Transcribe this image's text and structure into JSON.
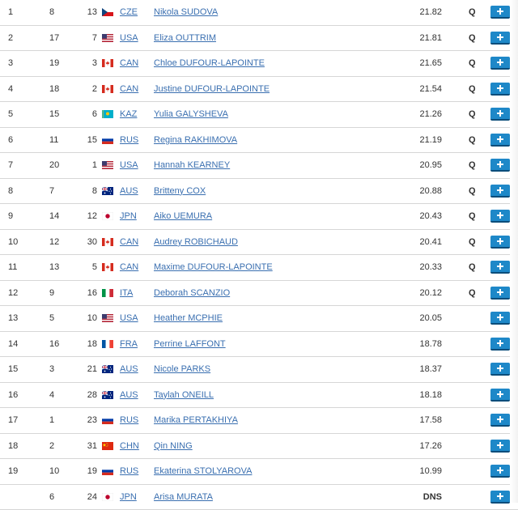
{
  "rows": [
    {
      "rank": "1",
      "bib": "8",
      "start": "13",
      "flag": "cze",
      "nation": "CZE",
      "athlete": "Nikola SUDOVA",
      "score": "21.82",
      "q": "Q"
    },
    {
      "rank": "2",
      "bib": "17",
      "start": "7",
      "flag": "usa",
      "nation": "USA",
      "athlete": "Eliza OUTTRIM",
      "score": "21.81",
      "q": "Q"
    },
    {
      "rank": "3",
      "bib": "19",
      "start": "3",
      "flag": "can",
      "nation": "CAN",
      "athlete": "Chloe DUFOUR-LAPOINTE",
      "score": "21.65",
      "q": "Q"
    },
    {
      "rank": "4",
      "bib": "18",
      "start": "2",
      "flag": "can",
      "nation": "CAN",
      "athlete": "Justine DUFOUR-LAPOINTE",
      "score": "21.54",
      "q": "Q"
    },
    {
      "rank": "5",
      "bib": "15",
      "start": "6",
      "flag": "kaz",
      "nation": "KAZ",
      "athlete": "Yulia GALYSHEVA",
      "score": "21.26",
      "q": "Q"
    },
    {
      "rank": "6",
      "bib": "11",
      "start": "15",
      "flag": "rus",
      "nation": "RUS",
      "athlete": "Regina RAKHIMOVA",
      "score": "21.19",
      "q": "Q"
    },
    {
      "rank": "7",
      "bib": "20",
      "start": "1",
      "flag": "usa",
      "nation": "USA",
      "athlete": "Hannah KEARNEY",
      "score": "20.95",
      "q": "Q"
    },
    {
      "rank": "8",
      "bib": "7",
      "start": "8",
      "flag": "aus",
      "nation": "AUS",
      "athlete": "Britteny COX",
      "score": "20.88",
      "q": "Q"
    },
    {
      "rank": "9",
      "bib": "14",
      "start": "12",
      "flag": "jpn",
      "nation": "JPN",
      "athlete": "Aiko UEMURA",
      "score": "20.43",
      "q": "Q"
    },
    {
      "rank": "10",
      "bib": "12",
      "start": "30",
      "flag": "can",
      "nation": "CAN",
      "athlete": "Audrey ROBICHAUD",
      "score": "20.41",
      "q": "Q"
    },
    {
      "rank": "11",
      "bib": "13",
      "start": "5",
      "flag": "can",
      "nation": "CAN",
      "athlete": "Maxime DUFOUR-LAPOINTE",
      "score": "20.33",
      "q": "Q"
    },
    {
      "rank": "12",
      "bib": "9",
      "start": "16",
      "flag": "ita",
      "nation": "ITA",
      "athlete": "Deborah SCANZIO",
      "score": "20.12",
      "q": "Q"
    },
    {
      "rank": "13",
      "bib": "5",
      "start": "10",
      "flag": "usa",
      "nation": "USA",
      "athlete": "Heather MCPHIE",
      "score": "20.05",
      "q": ""
    },
    {
      "rank": "14",
      "bib": "16",
      "start": "18",
      "flag": "fra",
      "nation": "FRA",
      "athlete": "Perrine LAFFONT",
      "score": "18.78",
      "q": ""
    },
    {
      "rank": "15",
      "bib": "3",
      "start": "21",
      "flag": "aus",
      "nation": "AUS",
      "athlete": "Nicole PARKS",
      "score": "18.37",
      "q": ""
    },
    {
      "rank": "16",
      "bib": "4",
      "start": "28",
      "flag": "aus",
      "nation": "AUS",
      "athlete": "Taylah ONEILL",
      "score": "18.18",
      "q": ""
    },
    {
      "rank": "17",
      "bib": "1",
      "start": "23",
      "flag": "rus",
      "nation": "RUS",
      "athlete": "Marika PERTAKHIYA",
      "score": "17.58",
      "q": ""
    },
    {
      "rank": "18",
      "bib": "2",
      "start": "31",
      "flag": "chn",
      "nation": "CHN",
      "athlete": "Qin NING",
      "score": "17.26",
      "q": ""
    },
    {
      "rank": "19",
      "bib": "10",
      "start": "19",
      "flag": "rus",
      "nation": "RUS",
      "athlete": "Ekaterina STOLYAROVA",
      "score": "10.99",
      "q": ""
    },
    {
      "rank": "",
      "bib": "6",
      "start": "24",
      "flag": "jpn",
      "nation": "JPN",
      "athlete": "Arisa MURATA",
      "score": "DNS",
      "q": ""
    }
  ],
  "expand_icon": "plus-icon",
  "colors": {
    "link": "#3a6fb0",
    "button": "#1e88c8",
    "divider": "#d6d6d6"
  }
}
